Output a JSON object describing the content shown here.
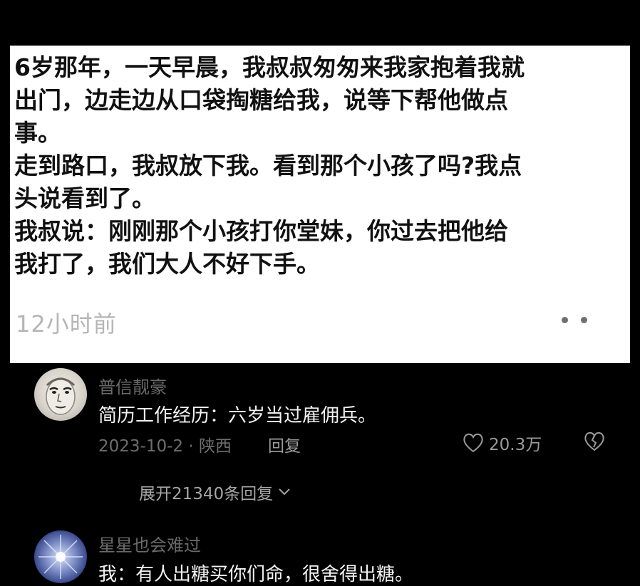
{
  "post": {
    "lines": [
      "6岁那年，一天早晨，我叔叔匆匆来我家抱着我就",
      "出门，边走边从口袋掏糖给我，说等下帮他做点",
      "事。",
      "走到路口，我叔放下我。看到那个小孩了吗?我点",
      "头说看到了。",
      "我叔说：刚刚那个小孩打你堂妹，你过去把他给",
      "我打了，我们大人不好下手。"
    ],
    "time": "12小时前"
  },
  "comments": [
    {
      "username": "普信靓豪",
      "text": "简历工作经历：六岁当过雇佣兵。",
      "date_location": "2023-10-2 · 陕西",
      "reply_label": "回复",
      "likes": "20.3万"
    },
    {
      "username": "星星也会难过",
      "text": "我：有人出糖买你们命，很舍得出糖。"
    }
  ],
  "expand_replies": "展开21340条回复",
  "colors": {
    "background": "#000000",
    "post_background": "#ffffff",
    "post_text": "#111111",
    "muted": "#6e6e6e"
  }
}
